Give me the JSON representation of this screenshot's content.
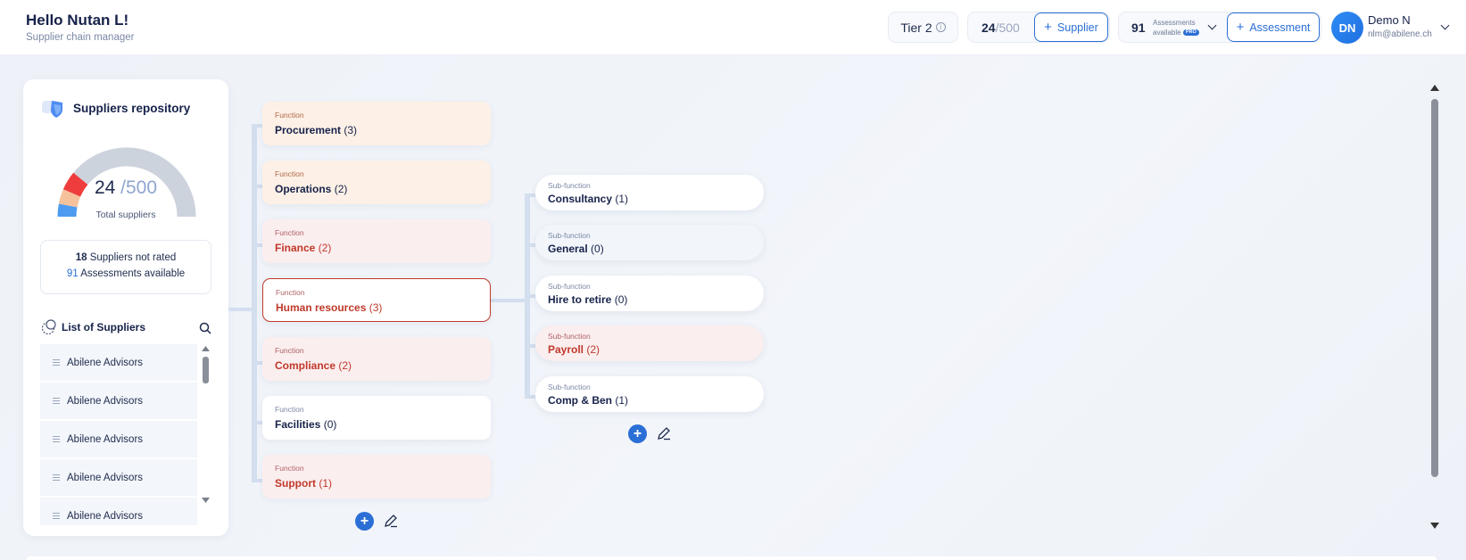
{
  "header": {
    "greeting": "Hello Nutan L!",
    "subtitle": "Supplier chain manager",
    "tier_label": "Tier 2",
    "supplier_count": "24",
    "supplier_max": "/500",
    "add_supplier_label": "Supplier",
    "assessments_count": "91",
    "assessments_label_line1": "Assessments",
    "assessments_label_line2": "available",
    "pro_badge": "PRO",
    "add_assessment_label": "Assessment",
    "avatar_initials": "DN",
    "user_name": "Demo N",
    "user_email": "nlm@abilene.ch"
  },
  "panel": {
    "title": "Suppliers repository",
    "total_count": "24",
    "total_max": "/500",
    "total_label": "Total suppliers",
    "not_rated_count": "18",
    "not_rated_label": "Suppliers not rated",
    "assessments_count": "91",
    "assessments_label": "Assessments available",
    "list_title": "List of Suppliers",
    "suppliers": [
      "Abilene Advisors",
      "Abilene Advisors",
      "Abilene Advisors",
      "Abilene Advisors",
      "Abilene Advisors"
    ],
    "gauge_segments": [
      {
        "label": "blue",
        "fraction": 0.06,
        "color": "#4d9bf0"
      },
      {
        "label": "peach",
        "fraction": 0.07,
        "color": "#f5c29b"
      },
      {
        "label": "red",
        "fraction": 0.09,
        "color": "#ef3d3d"
      },
      {
        "label": "grey",
        "fraction": 0.78,
        "color": "#cdd3dd"
      }
    ]
  },
  "functions": [
    {
      "label": "Function",
      "name": "Procurement",
      "count": "(3)",
      "tone": "orange"
    },
    {
      "label": "Function",
      "name": "Operations",
      "count": "(2)",
      "tone": "orange"
    },
    {
      "label": "Function",
      "name": "Finance",
      "count": "(2)",
      "tone": "pink"
    },
    {
      "label": "Function",
      "name": "Human resources",
      "count": "(3)",
      "tone": "selected"
    },
    {
      "label": "Function",
      "name": "Compliance",
      "count": "(2)",
      "tone": "pink"
    },
    {
      "label": "Function",
      "name": "Facilities",
      "count": "(0)",
      "tone": "white"
    },
    {
      "label": "Function",
      "name": "Support",
      "count": "(1)",
      "tone": "pink"
    }
  ],
  "subfunctions": [
    {
      "label": "Sub-function",
      "name": "Consultancy",
      "count": "(1)",
      "tone": "white"
    },
    {
      "label": "Sub-function",
      "name": "General",
      "count": "(0)",
      "tone": "grey"
    },
    {
      "label": "Sub-function",
      "name": "Hire to retire",
      "count": "(0)",
      "tone": "white"
    },
    {
      "label": "Sub-function",
      "name": "Payroll",
      "count": "(2)",
      "tone": "pink"
    },
    {
      "label": "Sub-function",
      "name": "Comp & Ben",
      "count": "(1)",
      "tone": "white"
    }
  ],
  "colors": {
    "accent": "#2b6fd6",
    "danger": "#c0392b"
  }
}
